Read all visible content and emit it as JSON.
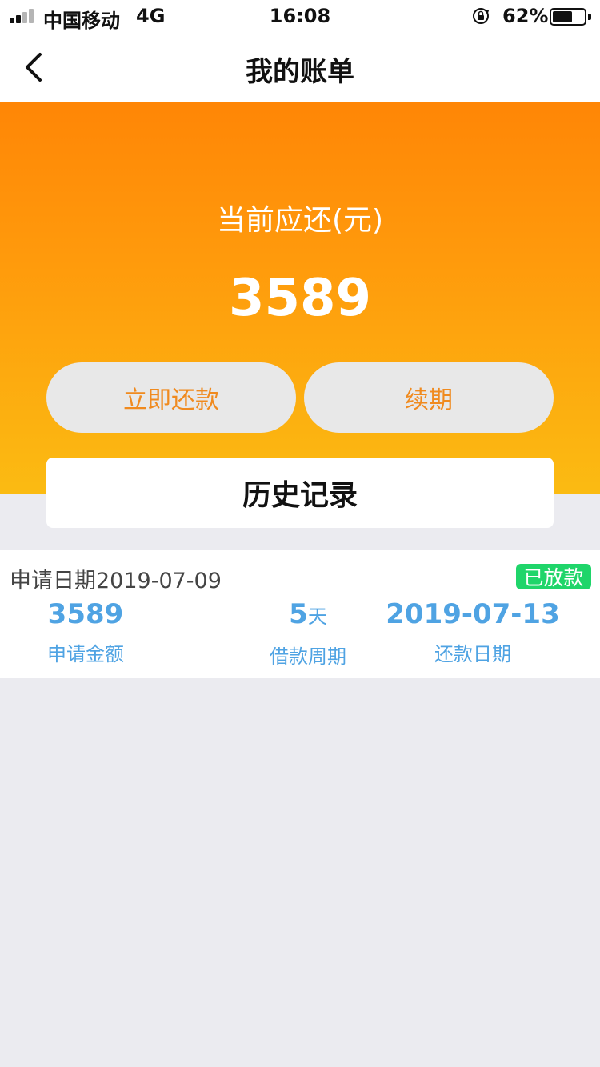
{
  "status_bar": {
    "carrier": "中国移动",
    "network": "4G",
    "time": "16:08",
    "battery_pct": "62%",
    "battery_level": 0.62
  },
  "nav": {
    "title": "我的账单",
    "back_icon": "chevron-left-icon"
  },
  "hero": {
    "label": "当前应还(元)",
    "amount": "3589",
    "repay_label": "立即还款",
    "renew_label": "续期",
    "history_label": "历史记录"
  },
  "record": {
    "apply_date": "申请日期2019-07-09",
    "status": "已放款",
    "amount_value": "3589",
    "amount_label": "申请金额",
    "period_value": "5",
    "period_unit": "天",
    "period_label": "借款周期",
    "repay_date_value": "2019-07-13",
    "repay_date_label": "还款日期"
  },
  "colors": {
    "accent_orange": "#ff8606",
    "accent_yellow": "#fbbb12",
    "button_text": "#f08a1e",
    "stat_blue": "#4fa3e3",
    "badge_green": "#1fd56a"
  }
}
